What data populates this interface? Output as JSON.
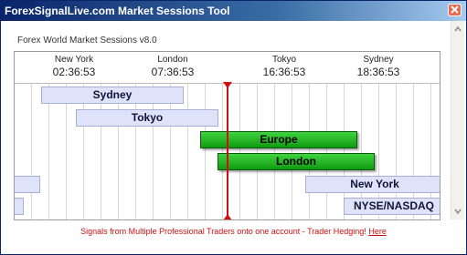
{
  "window": {
    "title": "ForexSignalLive.com Market Sessions Tool"
  },
  "app": {
    "subtitle": "Forex World Market Sessions v8.0"
  },
  "clocks": [
    {
      "city": "New York",
      "time": "02:36:53"
    },
    {
      "city": "London",
      "time": "07:36:53"
    },
    {
      "city": "Tokyo",
      "time": "16:36:53"
    },
    {
      "city": "Sydney",
      "time": "18:36:53"
    }
  ],
  "sessions": [
    {
      "name": "Sydney",
      "state": "closed"
    },
    {
      "name": "Tokyo",
      "state": "closed"
    },
    {
      "name": "Europe",
      "state": "open"
    },
    {
      "name": "London",
      "state": "open"
    },
    {
      "name": "New York",
      "state": "closed"
    },
    {
      "name": "NYSE/NASDAQ",
      "state": "closed"
    }
  ],
  "footer": {
    "text": "Signals from Multiple Professional Traders onto one account - Trader Hedging!",
    "link": "Here"
  },
  "colors": {
    "title_bar": "#0a246a",
    "open_session": "#1fb01f",
    "closed_session": "#dfe3fa",
    "now_line": "#d01010",
    "footer_text": "#cc1010"
  },
  "icons": {
    "close": "close-icon",
    "scroll_up": "arrow-up-icon",
    "scroll_down": "arrow-down-icon"
  }
}
